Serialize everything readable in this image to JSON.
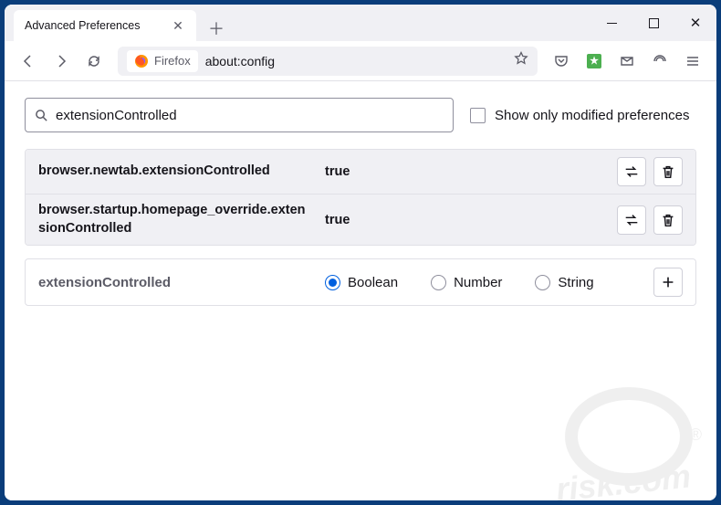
{
  "tab": {
    "title": "Advanced Preferences"
  },
  "toolbar": {
    "identity": "Firefox",
    "url": "about:config"
  },
  "search": {
    "value": "extensionControlled",
    "modified_label": "Show only modified preferences"
  },
  "prefs": [
    {
      "name": "browser.newtab.extensionControlled",
      "value": "true"
    },
    {
      "name": "browser.startup.homepage_override.extensionControlled",
      "value": "true"
    }
  ],
  "newPref": {
    "name": "extensionControlled",
    "types": {
      "boolean": "Boolean",
      "number": "Number",
      "string": "String"
    }
  }
}
